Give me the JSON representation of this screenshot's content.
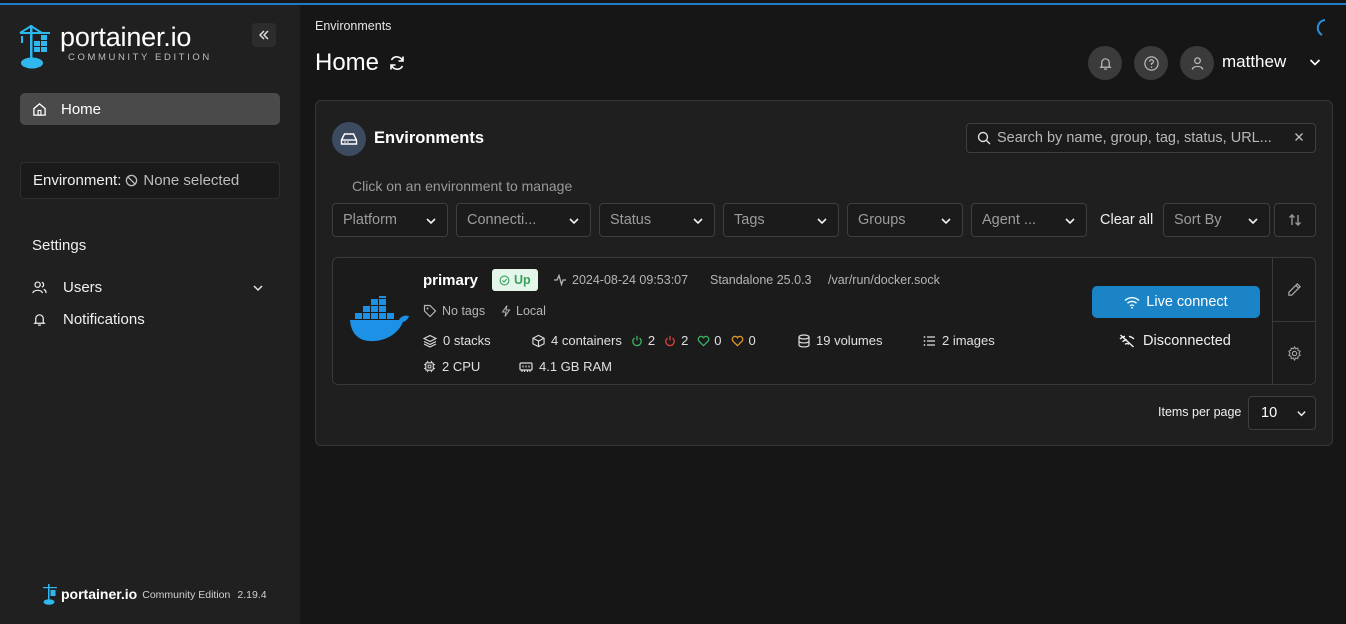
{
  "sidebar": {
    "logo_main": "portainer.io",
    "logo_sub": "COMMUNITY EDITION",
    "home_label": "Home",
    "environment_key": "Environment:",
    "environment_value": "None selected",
    "settings_heading": "Settings",
    "users_label": "Users",
    "notifications_label": "Notifications",
    "footer_brand": "portainer.io",
    "footer_edition": "Community Edition",
    "footer_version": "2.19.4"
  },
  "header": {
    "breadcrumb": "Environments",
    "title": "Home",
    "username": "matthew"
  },
  "panel": {
    "title": "Environments",
    "search_placeholder": "Search by name, group, tag, status, URL...",
    "hint": "Click on an environment to manage",
    "filters": [
      "Platform",
      "Connecti...",
      "Status",
      "Tags",
      "Groups",
      "Agent ..."
    ],
    "clear_all": "Clear all",
    "sort_by": "Sort By",
    "items_per_page_label": "Items per page",
    "items_per_page_value": "10"
  },
  "environment": {
    "name": "primary",
    "status": "Up",
    "timestamp": "2024-08-24 09:53:07",
    "type": "Standalone 25.0.3",
    "url": "/var/run/docker.sock",
    "tags": "No tags",
    "location": "Local",
    "stacks": "0 stacks",
    "containers": "4 containers",
    "running": "2",
    "stopped": "2",
    "healthy": "0",
    "unhealthy": "0",
    "volumes": "19 volumes",
    "images": "2 images",
    "cpu": "2 CPU",
    "ram": "4.1 GB RAM",
    "live_connect": "Live connect",
    "connection_state": "Disconnected"
  },
  "colors": {
    "accent": "#1a84c7",
    "running": "#3bb562",
    "stopped": "#d9413c",
    "healthy": "#3bb562",
    "unhealthy": "#e79a2a",
    "docker_blue": "#1d91e6"
  }
}
